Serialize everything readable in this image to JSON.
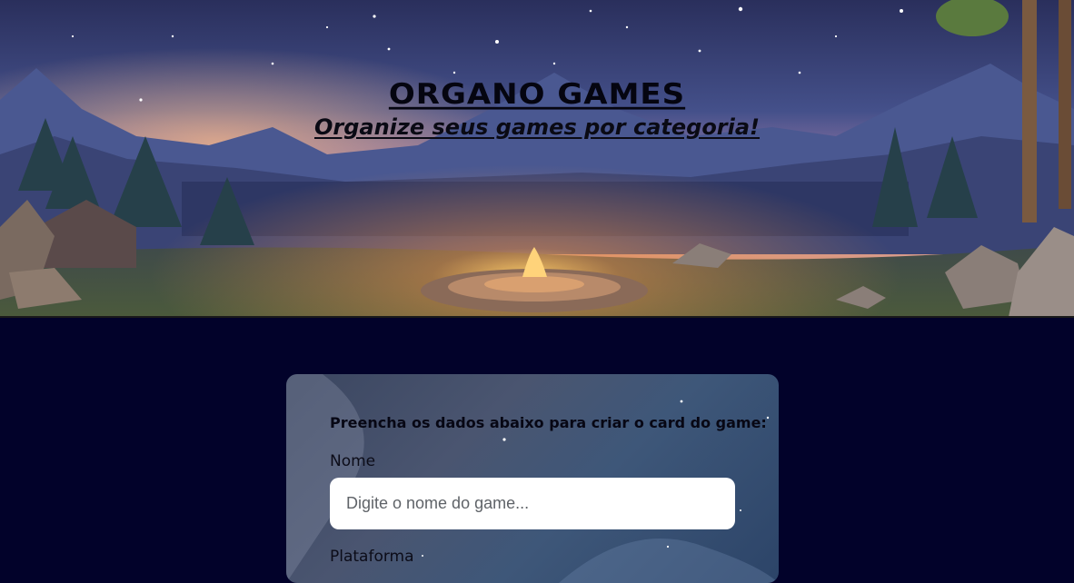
{
  "header": {
    "title": "ORGANO GAMES",
    "subtitle": "Organize seus games por categoria!"
  },
  "form": {
    "heading": "Preencha os dados abaixo para criar o card do game:",
    "fields": [
      {
        "label": "Nome",
        "placeholder": "Digite o nome do game...",
        "value": ""
      },
      {
        "label": "Plataforma"
      }
    ]
  },
  "colors": {
    "page_background": "#02022a",
    "sky_top": "#2a3563",
    "sunset_glow": "#e8a070",
    "campfire": "#ffb347",
    "input_background": "#ffffff"
  },
  "icons": [
    "campfire-illustration",
    "mountain-illustration",
    "pine-tree-illustration",
    "cabin-illustration"
  ]
}
